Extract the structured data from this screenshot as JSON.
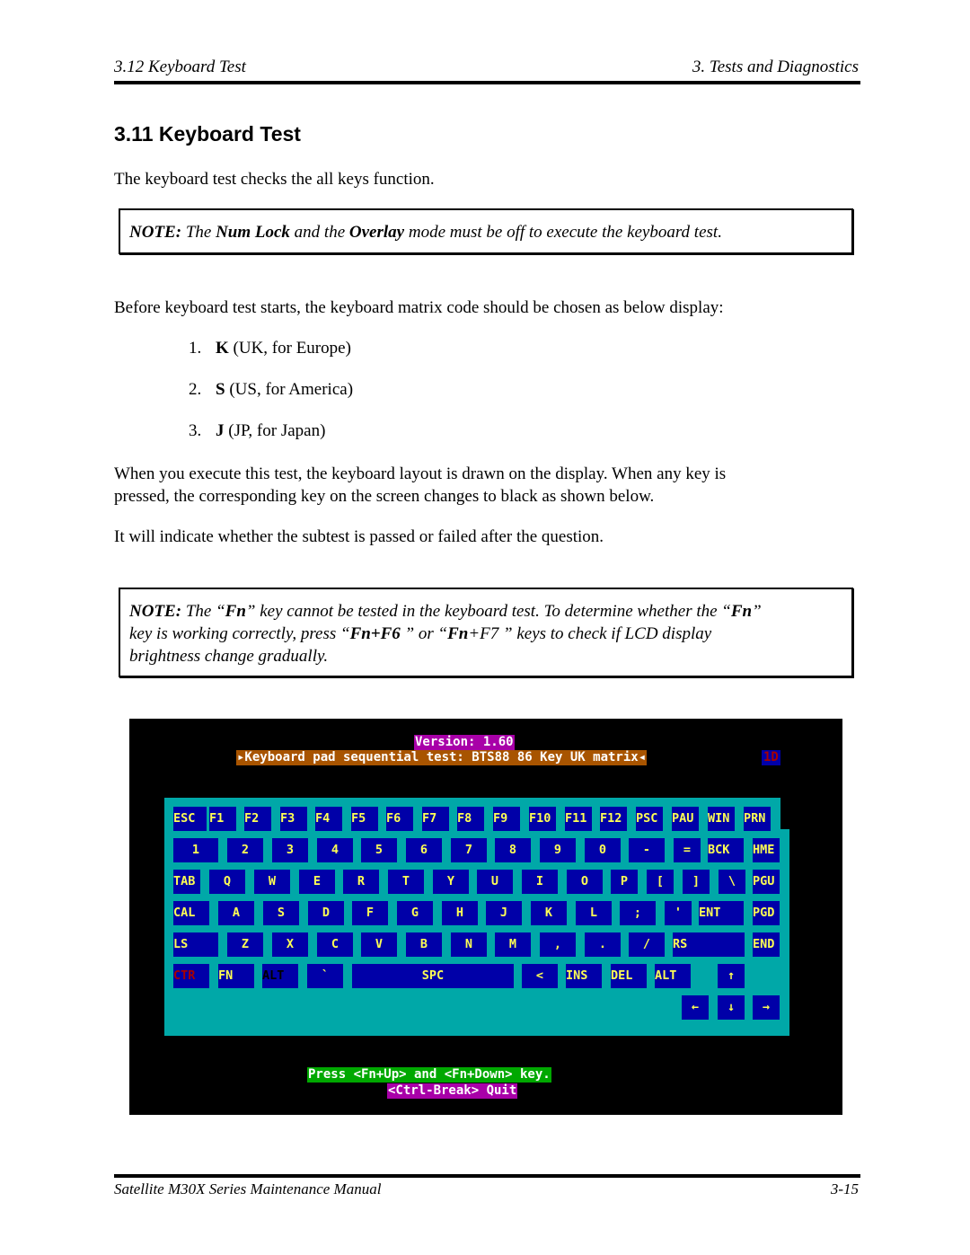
{
  "header": {
    "left": "3.12  Keyboard Test",
    "right": "3.  Tests and Diagnostics"
  },
  "section": {
    "title": "3.11  Keyboard Test"
  },
  "intro": "The keyboard test checks the all keys function.",
  "note1": {
    "label": "NOTE:",
    "t1": " The ",
    "b1": "Num Lock",
    "t2": " and the ",
    "b2": "Overlay",
    "t3": " mode must be off to execute the keyboard test."
  },
  "before_text": "Before keyboard test starts, the keyboard matrix code should be chosen as below display:",
  "options": [
    {
      "num": "1.",
      "key": "K",
      "desc": " (UK, for Europe)"
    },
    {
      "num": "2.",
      "key": "S",
      "desc": " (US, for America)"
    },
    {
      "num": "3.",
      "key": "J",
      "desc": " (JP, for Japan)"
    }
  ],
  "execute_text_1": "When you execute this test, the keyboard layout is drawn on the display. When any key is",
  "execute_text_2": "pressed, the corresponding key on the screen changes to black as shown below.",
  "indicate_text": "It will indicate whether the subtest is passed or failed after the question.",
  "note2": {
    "label": "NOTE:",
    "t1": " The “",
    "b1": "Fn",
    "t2": "” key cannot be tested in the keyboard test. To determine whether the “",
    "b2": "Fn",
    "t3": "”",
    "t4": "key is working correctly, press “",
    "b3": "Fn+F6",
    "t5": "    ” or “",
    "b4": "Fn",
    "t6": "+F7    ” keys  to check if LCD display",
    "t7": "brightness  change gradually."
  },
  "screen": {
    "version": "Version: 1.60",
    "title": "▸Keyboard pad sequential test: BTS88 86 Key UK matrix◂",
    "code": "1D",
    "press": "Press <Fn+Up> and <Fn+Down> key.",
    "quit": "<Ctrl-Break> Quit",
    "keyboard_rows": [
      [
        "ESC",
        "F1",
        "F2",
        "F3",
        "F4",
        "F5",
        "F6",
        "F7",
        "F8",
        "F9",
        "F10",
        "F11",
        "F12",
        "PSC",
        "PAU",
        "WIN",
        "PRN"
      ],
      [
        "1",
        "2",
        "3",
        "4",
        "5",
        "6",
        "7",
        "8",
        "9",
        "0",
        "-",
        "=",
        "BCK",
        "HME"
      ],
      [
        "TAB",
        "Q",
        "W",
        "E",
        "R",
        "T",
        "Y",
        "U",
        "I",
        "O",
        "P",
        "[",
        "]",
        "\\",
        "PGU"
      ],
      [
        "CAL",
        "A",
        "S",
        "D",
        "F",
        "G",
        "H",
        "J",
        "K",
        "L",
        ";",
        "'",
        "ENT",
        "PGD"
      ],
      [
        "LS",
        "Z",
        "X",
        "C",
        "V",
        "B",
        "N",
        "M",
        ",",
        ".",
        "/",
        "RS",
        "END"
      ],
      [
        "CTR",
        "FN",
        "ALT",
        "`",
        "SPC",
        "<",
        "INS",
        "DEL",
        "ALT",
        "↑"
      ],
      [
        "←",
        "↓",
        "→"
      ]
    ],
    "key_states": {
      "CTR": "pressed-red",
      "ALT_left": "pressed-black"
    }
  },
  "footer": {
    "left": "Satellite M30X Series Maintenance Manual",
    "right": "3-15"
  }
}
